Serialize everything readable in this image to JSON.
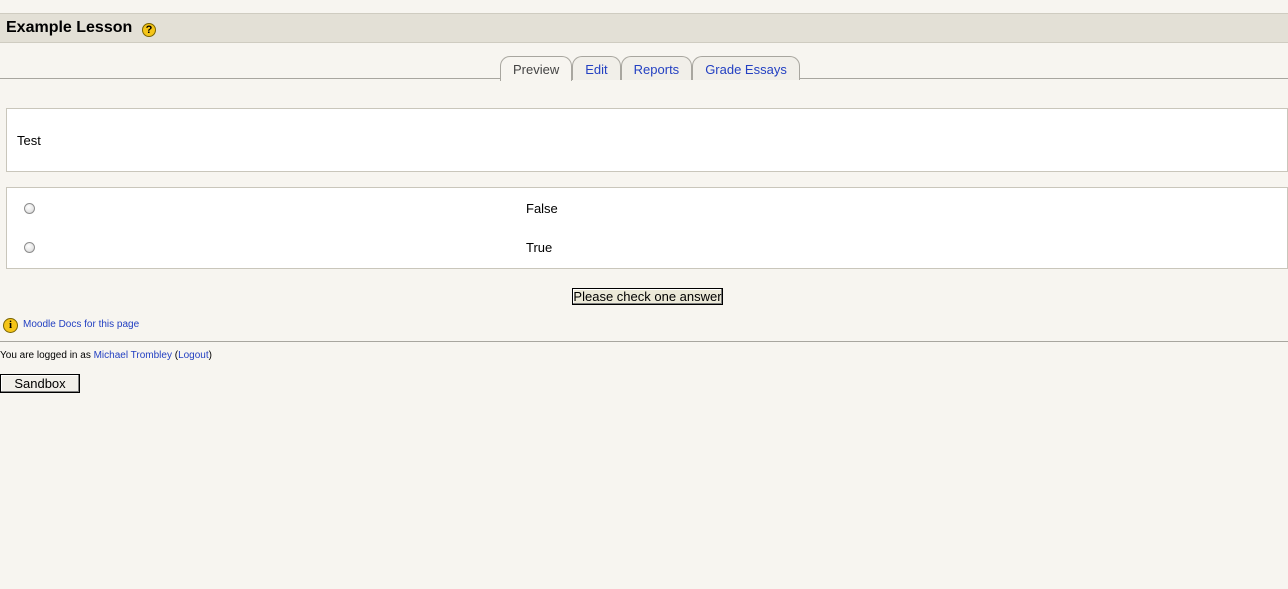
{
  "header": {
    "title": "Example Lesson",
    "help_icon": "question-mark-icon",
    "help_symbol": "?"
  },
  "tabs": [
    {
      "label": "Preview",
      "active": true
    },
    {
      "label": "Edit",
      "active": false
    },
    {
      "label": "Reports",
      "active": false
    },
    {
      "label": "Grade Essays",
      "active": false
    }
  ],
  "content": {
    "text": "Test"
  },
  "answers": [
    {
      "label": "False",
      "checked": false
    },
    {
      "label": "True",
      "checked": false
    }
  ],
  "submit": {
    "label": "Please check one answer"
  },
  "docs": {
    "icon": "info-icon",
    "icon_symbol": "i",
    "link_text": "Moodle Docs for this page"
  },
  "footer": {
    "logged_in_prefix": "You are logged in as ",
    "user_name": "Michael Trombley",
    "open_paren": " (",
    "logout_label": "Logout",
    "close_paren": ")",
    "home_button": "Sandbox"
  },
  "colors": {
    "link": "#2340c2",
    "background": "#f7f5f0",
    "header_bar": "#e3e0d6"
  }
}
